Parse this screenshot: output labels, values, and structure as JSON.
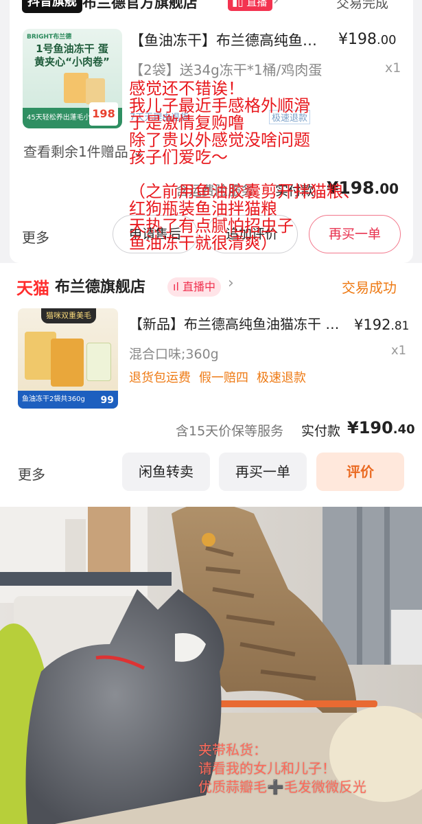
{
  "order1": {
    "platform_badge": "抖音旗舰",
    "shop_name": "布兰德官方旗舰店",
    "live_label": "直播",
    "status": "交易完成",
    "product_title": "【鱼油冻干】布兰德高纯鱼…",
    "price_int": "¥198",
    "price_dec": ".00",
    "spec": "【2袋】送34g冻干*1桶/鸡肉蛋",
    "qty": "x1",
    "remaining": "查看剩余1件赠品",
    "insurance": "含运费险服务",
    "paid_label": "实付款",
    "total_int": "¥198",
    "total_dec": ".00",
    "more": "更多",
    "buttons": [
      "申请售后",
      "追加评价",
      "再买一单"
    ],
    "tiny_tags": [
      "7天无理由退货",
      "极速退款"
    ],
    "thumb": {
      "brand": "BRIGHT布兰德",
      "headline": "1号鱼油冻干 蛋黄夹心“小肉卷”",
      "bar_text": "45天轻松养出蓬毛小猫",
      "price": "198"
    }
  },
  "review_overlay": "感觉还不错诶！\n我儿子最近手感格外顺滑\n于是激情复购噜\n除了贵以外感觉没啥问题\n孩子们爱吃～\n\n（之前用鱼油胶囊剪开拌猫粮、\n红狗瓶装鱼油拌猫粮\n天热了有点腻怕招虫子\n鱼油冻干就很清爽）",
  "order2": {
    "platform_logo": "天猫",
    "shop_name": "布兰德旗舰店",
    "live_label": "直播中",
    "status": "交易成功",
    "product_title": "【新品】布兰德高纯鱼油猫冻干 o…",
    "price_int": "¥192",
    "price_dec": ".81",
    "spec": "混合口味;360g",
    "qty": "x1",
    "tags": [
      "退货包运费",
      "假一赔四",
      "极速退款"
    ],
    "guarantee": "含15天价保等服务",
    "paid_label": "实付款",
    "total_int": "¥190",
    "total_dec": ".40",
    "more": "更多",
    "buttons": [
      "闲鱼转卖",
      "再买一单",
      "评价"
    ],
    "thumb": {
      "top_label": "猫咪双重美毛",
      "bottom_label": "鱼油冻干2袋共360g",
      "price": "99"
    }
  },
  "photo_caption": "夹带私货：\n请看我的女儿和儿子！\n优质蒜瓣毛➕毛发微微反光",
  "colors": {
    "review_red": "#e8191e",
    "tmall_orange": "#ee7a14",
    "live_red": "#f33350",
    "caption_pink": "#ff6a5a"
  }
}
